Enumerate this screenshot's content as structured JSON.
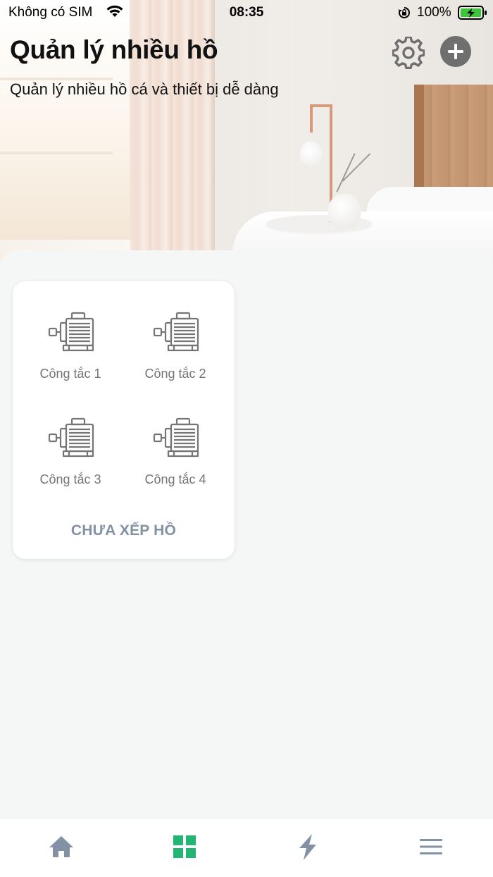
{
  "status_bar": {
    "carrier": "Không có SIM",
    "time": "08:35",
    "battery_percent": "100%"
  },
  "header": {
    "title": "Quản lý nhiều hồ",
    "subtitle": "Quản lý nhiều hồ cá và thiết bị dễ dàng",
    "settings_icon": "gear-icon",
    "add_icon": "plus-circle-icon"
  },
  "group": {
    "name": "CHƯA XẾP HỒ",
    "devices": [
      {
        "label": "Công tắc 1",
        "icon": "motor-icon"
      },
      {
        "label": "Công tắc 2",
        "icon": "motor-icon"
      },
      {
        "label": "Công tắc 3",
        "icon": "motor-icon"
      },
      {
        "label": "Công tắc 4",
        "icon": "motor-icon"
      }
    ]
  },
  "tabbar": {
    "tabs": [
      {
        "icon": "home-icon",
        "active": false
      },
      {
        "icon": "grid-icon",
        "active": true
      },
      {
        "icon": "lightning-icon",
        "active": false
      },
      {
        "icon": "menu-icon",
        "active": false
      }
    ]
  },
  "colors": {
    "accent_active": "#22b573",
    "tab_inactive": "#8391a5",
    "group_label": "#8391a5",
    "icon_gray": "#757575"
  }
}
